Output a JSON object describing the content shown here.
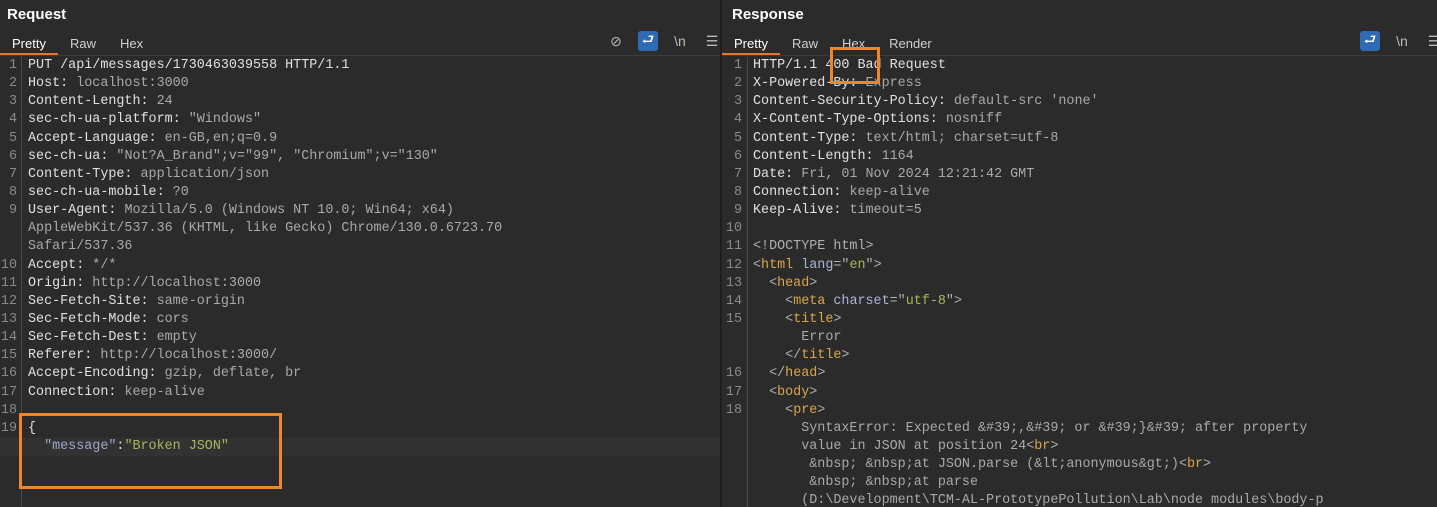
{
  "request": {
    "title": "Request",
    "tabs": [
      "Pretty",
      "Raw",
      "Hex"
    ],
    "active_tab": "Pretty",
    "tools": [
      "eye-off-icon",
      "wrap-icon",
      "newline-icon",
      "menu-icon"
    ],
    "lines": [
      {
        "n": "1",
        "segs": [
          {
            "t": "PUT /api/messages/1730463039558 HTTP/1.1",
            "c": "k"
          }
        ]
      },
      {
        "n": "2",
        "segs": [
          {
            "t": "Host: ",
            "c": "k"
          },
          {
            "t": "localhost:3000",
            "c": "v"
          }
        ]
      },
      {
        "n": "3",
        "segs": [
          {
            "t": "Content-Length: ",
            "c": "k"
          },
          {
            "t": "24",
            "c": "v"
          }
        ]
      },
      {
        "n": "4",
        "segs": [
          {
            "t": "sec-ch-ua-platform: ",
            "c": "k"
          },
          {
            "t": "\"Windows\"",
            "c": "v"
          }
        ]
      },
      {
        "n": "5",
        "segs": [
          {
            "t": "Accept-Language: ",
            "c": "k"
          },
          {
            "t": "en-GB,en;q=0.9",
            "c": "v"
          }
        ]
      },
      {
        "n": "6",
        "segs": [
          {
            "t": "sec-ch-ua: ",
            "c": "k"
          },
          {
            "t": "\"Not?A_Brand\";v=\"99\", \"Chromium\";v=\"130\"",
            "c": "v"
          }
        ]
      },
      {
        "n": "7",
        "segs": [
          {
            "t": "Content-Type: ",
            "c": "k"
          },
          {
            "t": "application/json",
            "c": "v"
          }
        ]
      },
      {
        "n": "8",
        "segs": [
          {
            "t": "sec-ch-ua-mobile: ",
            "c": "k"
          },
          {
            "t": "?0",
            "c": "v"
          }
        ]
      },
      {
        "n": "9",
        "segs": [
          {
            "t": "User-Agent: ",
            "c": "k"
          },
          {
            "t": "Mozilla/5.0 (Windows NT 10.0; Win64; x64)",
            "c": "v"
          }
        ]
      },
      {
        "n": "",
        "segs": [
          {
            "t": "AppleWebKit/537.36 (KHTML, like Gecko) Chrome/130.0.6723.70",
            "c": "v"
          }
        ]
      },
      {
        "n": "",
        "segs": [
          {
            "t": "Safari/537.36",
            "c": "v"
          }
        ]
      },
      {
        "n": "10",
        "segs": [
          {
            "t": "Accept: ",
            "c": "k"
          },
          {
            "t": "*/*",
            "c": "v"
          }
        ]
      },
      {
        "n": "11",
        "segs": [
          {
            "t": "Origin: ",
            "c": "k"
          },
          {
            "t": "http://localhost:3000",
            "c": "v"
          }
        ]
      },
      {
        "n": "12",
        "segs": [
          {
            "t": "Sec-Fetch-Site: ",
            "c": "k"
          },
          {
            "t": "same-origin",
            "c": "v"
          }
        ]
      },
      {
        "n": "13",
        "segs": [
          {
            "t": "Sec-Fetch-Mode: ",
            "c": "k"
          },
          {
            "t": "cors",
            "c": "v"
          }
        ]
      },
      {
        "n": "14",
        "segs": [
          {
            "t": "Sec-Fetch-Dest: ",
            "c": "k"
          },
          {
            "t": "empty",
            "c": "v"
          }
        ]
      },
      {
        "n": "15",
        "segs": [
          {
            "t": "Referer: ",
            "c": "k"
          },
          {
            "t": "http://localhost:3000/",
            "c": "v"
          }
        ]
      },
      {
        "n": "16",
        "segs": [
          {
            "t": "Accept-Encoding: ",
            "c": "k"
          },
          {
            "t": "gzip, deflate, br",
            "c": "v"
          }
        ]
      },
      {
        "n": "17",
        "segs": [
          {
            "t": "Connection: ",
            "c": "k"
          },
          {
            "t": "keep-alive",
            "c": "v"
          }
        ]
      },
      {
        "n": "18",
        "segs": []
      },
      {
        "n": "19",
        "segs": [
          {
            "t": "{",
            "c": "k"
          }
        ]
      },
      {
        "n": "",
        "segs": [
          {
            "t": "  \"message\"",
            "c": "q"
          },
          {
            "t": ":",
            "c": "k"
          },
          {
            "t": "\"Broken JSON\"",
            "c": "s"
          }
        ],
        "hl": true
      }
    ]
  },
  "response": {
    "title": "Response",
    "tabs": [
      "Pretty",
      "Raw",
      "Hex",
      "Render"
    ],
    "active_tab": "Pretty",
    "tools": [
      "wrap-icon",
      "newline-icon",
      "menu-icon"
    ],
    "lines": [
      {
        "n": "1",
        "segs": [
          {
            "t": "HTTP/1.1 400 Bad Request",
            "c": "k"
          }
        ]
      },
      {
        "n": "2",
        "segs": [
          {
            "t": "X-Powered-By: ",
            "c": "k"
          },
          {
            "t": "Express",
            "c": "v"
          }
        ]
      },
      {
        "n": "3",
        "segs": [
          {
            "t": "Content-Security-Policy: ",
            "c": "k"
          },
          {
            "t": "default-src 'none'",
            "c": "v"
          }
        ]
      },
      {
        "n": "4",
        "segs": [
          {
            "t": "X-Content-Type-Options: ",
            "c": "k"
          },
          {
            "t": "nosniff",
            "c": "v"
          }
        ]
      },
      {
        "n": "5",
        "segs": [
          {
            "t": "Content-Type: ",
            "c": "k"
          },
          {
            "t": "text/html; charset=utf-8",
            "c": "v"
          }
        ]
      },
      {
        "n": "6",
        "segs": [
          {
            "t": "Content-Length: ",
            "c": "k"
          },
          {
            "t": "1164",
            "c": "v"
          }
        ]
      },
      {
        "n": "7",
        "segs": [
          {
            "t": "Date: ",
            "c": "k"
          },
          {
            "t": "Fri, 01 Nov 2024 12:21:42 GMT",
            "c": "v"
          }
        ]
      },
      {
        "n": "8",
        "segs": [
          {
            "t": "Connection: ",
            "c": "k"
          },
          {
            "t": "keep-alive",
            "c": "v"
          }
        ]
      },
      {
        "n": "9",
        "segs": [
          {
            "t": "Keep-Alive: ",
            "c": "k"
          },
          {
            "t": "timeout=5",
            "c": "v"
          }
        ]
      },
      {
        "n": "10",
        "segs": []
      },
      {
        "n": "11",
        "segs": [
          {
            "t": "<!DOCTYPE html>",
            "c": "br"
          }
        ]
      },
      {
        "n": "12",
        "segs": [
          {
            "t": "<",
            "c": "br"
          },
          {
            "t": "html",
            "c": "tg"
          },
          {
            "t": " lang",
            "c": "an"
          },
          {
            "t": "=\"",
            "c": "br"
          },
          {
            "t": "en",
            "c": "av"
          },
          {
            "t": "\">",
            "c": "br"
          }
        ]
      },
      {
        "n": "13",
        "segs": [
          {
            "t": "  <",
            "c": "br"
          },
          {
            "t": "head",
            "c": "tg"
          },
          {
            "t": ">",
            "c": "br"
          }
        ]
      },
      {
        "n": "14",
        "segs": [
          {
            "t": "    <",
            "c": "br"
          },
          {
            "t": "meta",
            "c": "tg"
          },
          {
            "t": " charset",
            "c": "an"
          },
          {
            "t": "=\"",
            "c": "br"
          },
          {
            "t": "utf-8",
            "c": "av"
          },
          {
            "t": "\">",
            "c": "br"
          }
        ]
      },
      {
        "n": "15",
        "segs": [
          {
            "t": "    <",
            "c": "br"
          },
          {
            "t": "title",
            "c": "tg"
          },
          {
            "t": ">",
            "c": "br"
          }
        ]
      },
      {
        "n": "",
        "segs": [
          {
            "t": "      Error",
            "c": "v"
          }
        ]
      },
      {
        "n": "",
        "segs": [
          {
            "t": "    </",
            "c": "br"
          },
          {
            "t": "title",
            "c": "tg"
          },
          {
            "t": ">",
            "c": "br"
          }
        ]
      },
      {
        "n": "16",
        "segs": [
          {
            "t": "  </",
            "c": "br"
          },
          {
            "t": "head",
            "c": "tg"
          },
          {
            "t": ">",
            "c": "br"
          }
        ]
      },
      {
        "n": "17",
        "segs": [
          {
            "t": "  <",
            "c": "br"
          },
          {
            "t": "body",
            "c": "tg"
          },
          {
            "t": ">",
            "c": "br"
          }
        ]
      },
      {
        "n": "18",
        "segs": [
          {
            "t": "    <",
            "c": "br"
          },
          {
            "t": "pre",
            "c": "tg"
          },
          {
            "t": ">",
            "c": "br"
          }
        ]
      },
      {
        "n": "",
        "segs": [
          {
            "t": "      SyntaxError: Expected &#39;,&#39; or &#39;}&#39; after property",
            "c": "v"
          }
        ]
      },
      {
        "n": "",
        "segs": [
          {
            "t": "      value in JSON at position 24<",
            "c": "v"
          },
          {
            "t": "br",
            "c": "tg"
          },
          {
            "t": ">",
            "c": "br"
          }
        ]
      },
      {
        "n": "",
        "segs": [
          {
            "t": "       &nbsp; &nbsp;at JSON.parse (&lt;anonymous&gt;)<",
            "c": "v"
          },
          {
            "t": "br",
            "c": "tg"
          },
          {
            "t": ">",
            "c": "br"
          }
        ]
      },
      {
        "n": "",
        "segs": [
          {
            "t": "       &nbsp; &nbsp;at parse",
            "c": "v"
          }
        ]
      },
      {
        "n": "",
        "segs": [
          {
            "t": "      (D:\\Development\\TCM-AL-PrototypePollution\\Lab\\node modules\\body-p",
            "c": "v"
          }
        ]
      }
    ]
  },
  "colors": {
    "highlight_box": "#f0862a",
    "tab_underline": "#e8742e",
    "tool_active": "#2f6bb5"
  }
}
